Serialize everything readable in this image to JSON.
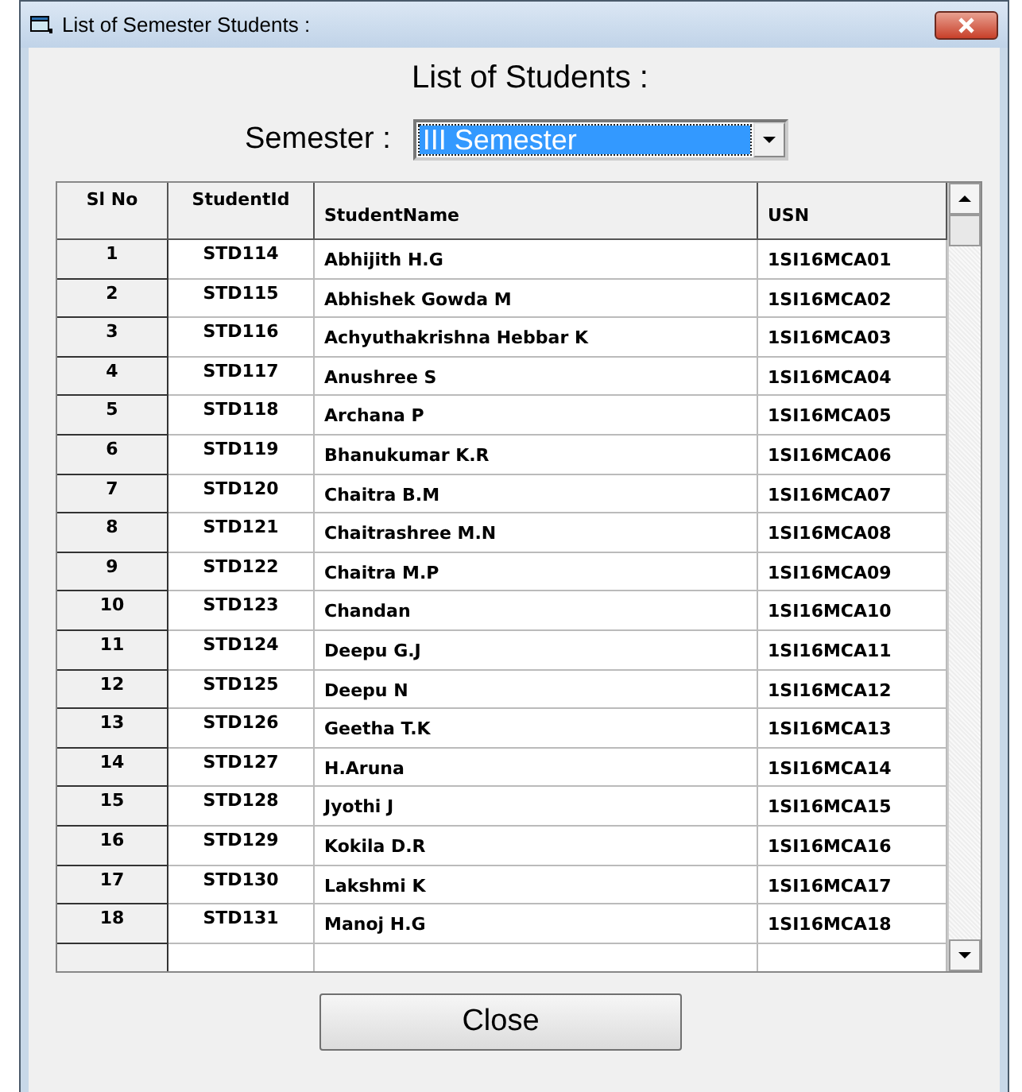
{
  "window": {
    "title": "List of Semester Students :"
  },
  "heading": "List of Students :",
  "semester": {
    "label": "Semester :",
    "value": "III Semester"
  },
  "table": {
    "columns": [
      "Sl No",
      "StudentId",
      "StudentName",
      "USN"
    ],
    "rows": [
      [
        "1",
        "STD114",
        "Abhijith H.G",
        "1SI16MCA01"
      ],
      [
        "2",
        "STD115",
        "Abhishek Gowda M",
        "1SI16MCA02"
      ],
      [
        "3",
        "STD116",
        "Achyuthakrishna Hebbar K",
        "1SI16MCA03"
      ],
      [
        "4",
        "STD117",
        "Anushree S",
        "1SI16MCA04"
      ],
      [
        "5",
        "STD118",
        "Archana P",
        "1SI16MCA05"
      ],
      [
        "6",
        "STD119",
        "Bhanukumar K.R",
        "1SI16MCA06"
      ],
      [
        "7",
        "STD120",
        "Chaitra B.M",
        "1SI16MCA07"
      ],
      [
        "8",
        "STD121",
        "Chaitrashree M.N",
        "1SI16MCA08"
      ],
      [
        "9",
        "STD122",
        "Chaitra M.P",
        "1SI16MCA09"
      ],
      [
        "10",
        "STD123",
        "Chandan",
        "1SI16MCA10"
      ],
      [
        "11",
        "STD124",
        "Deepu G.J",
        "1SI16MCA11"
      ],
      [
        "12",
        "STD125",
        "Deepu N",
        "1SI16MCA12"
      ],
      [
        "13",
        "STD126",
        "Geetha T.K",
        "1SI16MCA13"
      ],
      [
        "14",
        "STD127",
        "H.Aruna",
        "1SI16MCA14"
      ],
      [
        "15",
        "STD128",
        "Jyothi J",
        "1SI16MCA15"
      ],
      [
        "16",
        "STD129",
        "Kokila D.R",
        "1SI16MCA16"
      ],
      [
        "17",
        "STD130",
        "Lakshmi K",
        "1SI16MCA17"
      ],
      [
        "18",
        "STD131",
        "Manoj H.G",
        "1SI16MCA18"
      ]
    ]
  },
  "close_button": "Close"
}
